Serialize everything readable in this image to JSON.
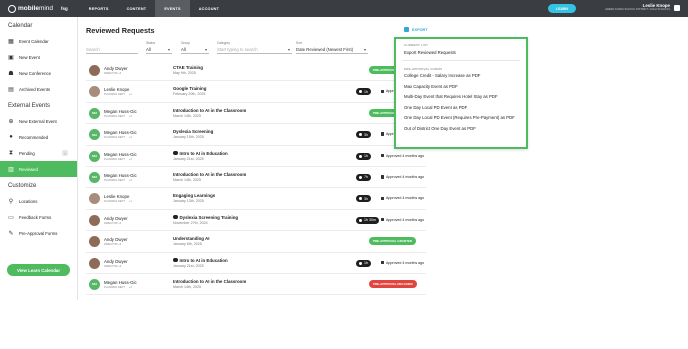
{
  "topbar": {
    "logo_bold": "mobile",
    "logo_light": "mind",
    "logo_badge": "fsg",
    "nav": [
      "REPORTS",
      "CONTENT",
      "EVENTS",
      "ACCOUNT"
    ],
    "learn_label": "LEARN",
    "user_name": "Leslie Knope",
    "user_org": "GREEN ACRES SCHOOL DISTRICT / HIGH SCHOOLS"
  },
  "sidebar": {
    "calendar_heading": "Calendar",
    "calendar_items": [
      "Event Calendar",
      "New Event",
      "New Conference",
      "Archived Events"
    ],
    "external_heading": "External Events",
    "external_items": [
      "New External Event",
      "Recommended",
      "Pending",
      "Reviewed"
    ],
    "customize_heading": "Customize",
    "customize_items": [
      "Locations",
      "Feedback Forms",
      "Pre-Approval Forms"
    ],
    "learn_button": "View Learn Calendar"
  },
  "main": {
    "title": "Reviewed Requests",
    "export_label": "EXPORT",
    "filters": {
      "status_label": "Status",
      "status_value": "All",
      "group_label": "Group",
      "group_value": "All",
      "category_label": "Category",
      "category_placeholder": "Start typing to search",
      "sort_label": "Sort",
      "sort_value": "Date Reviewed (Newest First)",
      "search_placeholder": "Search"
    }
  },
  "rows": [
    {
      "name": "Andy Dwyer",
      "sub": "DIRECTOR +4",
      "event": "CTAE Training",
      "date": "May 9th, 2025",
      "hours": "",
      "status": "",
      "badge": "PRE-APPROVAL GRANTED",
      "badge_color": "#4dbb5e",
      "avatar": "photo",
      "check": false
    },
    {
      "name": "Leslie Knope",
      "sub": "PLANNING DEPT",
      "plus": "+1",
      "event": "Google Training",
      "date": "February 20th, 2025",
      "hours": "1h",
      "status": "Approved 4 months ago",
      "badge": "",
      "avatar": "photo2",
      "check": false
    },
    {
      "name": "Megan Huss-Gic",
      "sub": "PLANNING DEPT",
      "plus": "+3",
      "event": "Introduction to AI in the Classroom",
      "date": "March 14th, 2025",
      "hours": "",
      "status": "",
      "badge": "PRE-APPROVAL GRANTED",
      "badge_color": "#4dbb5e",
      "avatar": "green",
      "check": false
    },
    {
      "name": "Megan Huss-Gic",
      "sub": "PLANNING DEPT",
      "plus": "+3",
      "event": "Dyslexia Screening",
      "date": "January 15th, 2025",
      "hours": "3h",
      "status": "Approved 4 months ago",
      "badge": "",
      "avatar": "green",
      "check": false
    },
    {
      "name": "Megan Huss-Gic",
      "sub": "PLANNING DEPT",
      "plus": "+3",
      "event": "Intro to AI in Education",
      "date": "January 21st, 2025",
      "hours": "1h",
      "status": "Approved 4 months ago",
      "badge": "",
      "avatar": "green",
      "check": true
    },
    {
      "name": "Megan Huss-Gic",
      "sub": "PLANNING DEPT",
      "plus": "+3",
      "event": "Introduction to AI in the Classroom",
      "date": "March 14th, 2025",
      "hours": "7h",
      "status": "Approved 4 months ago",
      "badge": "",
      "avatar": "green",
      "check": false
    },
    {
      "name": "Leslie Knope",
      "sub": "PLANNING DEPT",
      "plus": "+1",
      "event": "Engaging Learnings",
      "date": "January 13th, 2025",
      "hours": "3h",
      "status": "Approved 4 months ago",
      "badge": "",
      "avatar": "photo2",
      "check": false
    },
    {
      "name": "Andy Dwyer",
      "sub": "DIRECTOR +4",
      "event": "Dyslexia Screening Training",
      "date": "November 27th, 2024",
      "hours": "1h 30m",
      "status": "Approved 4 months ago",
      "badge": "",
      "avatar": "photo",
      "check": true
    },
    {
      "name": "Andy Dwyer",
      "sub": "DIRECTOR +4",
      "event": "Understanding AI",
      "date": "January 6th, 2025",
      "hours": "",
      "status": "",
      "badge": "PRE-APPROVAL GRANTED",
      "badge_color": "#4dbb5e",
      "avatar": "photo",
      "check": false
    },
    {
      "name": "Andy Dwyer",
      "sub": "DIRECTOR +4",
      "event": "Intro to AI in Education",
      "date": "January 21st, 2025",
      "hours": "1h",
      "status": "Approved 4 months ago",
      "badge": "",
      "avatar": "photo",
      "check": true
    },
    {
      "name": "Megan Huss-Gic",
      "sub": "PLANNING DEPT",
      "plus": "+3",
      "event": "Introduction to AI in the Classroom",
      "date": "March 14th, 2025",
      "hours": "",
      "status": "",
      "badge": "PRE-APPROVAL DECLINED",
      "badge_color": "#e0453f",
      "avatar": "green",
      "check": false
    }
  ],
  "dropdown": {
    "current_heading": "CURRENT LIST",
    "current_items": [
      "Export Reviewed Requests"
    ],
    "forms_heading": "PRE-APPROVAL FORMS",
    "form_items": [
      "College Credit - Salary Increase as PDF",
      "Max Capacity Event as PDF",
      "Multi-Day Event that Requires Hotel Stay as PDF",
      "One Day Local PD Event as PDF",
      "One Day Local PD Event (Requires Pre-Payment) as PDF",
      "Out of District One Day Event as PDF"
    ]
  },
  "colors": {
    "accent_green": "#4dbb5e",
    "topbar": "#3a3d42",
    "learn_blue": "#35c3e4",
    "declined_red": "#e0453f"
  }
}
